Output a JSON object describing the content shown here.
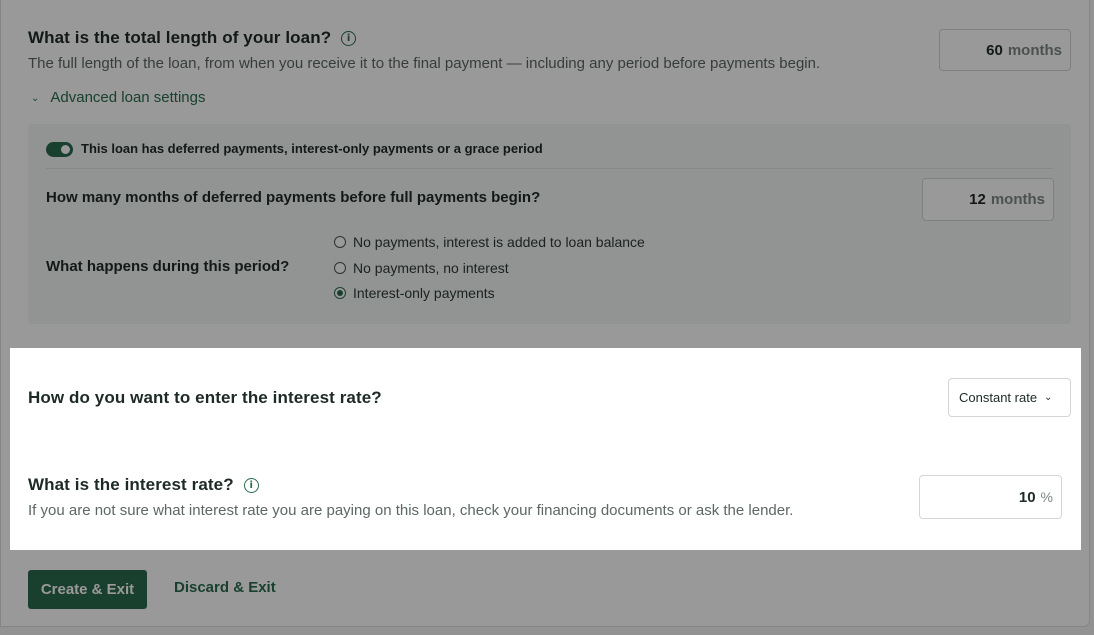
{
  "loan_length": {
    "question": "What is the total length of your loan?",
    "description": "The full length of the loan, from when you receive it to the final payment — including any period before payments begin.",
    "value": "60",
    "unit": "months"
  },
  "advanced_settings": {
    "label": "Advanced loan settings",
    "toggle_label": "This loan has deferred payments, interest-only payments or a grace period",
    "toggle_on": true,
    "deferred_question": "How many months of deferred payments before full payments begin?",
    "deferred_value": "12",
    "deferred_unit": "months",
    "period_question": "What happens during this period?",
    "period_options": [
      {
        "label": "No payments, interest is added to loan balance",
        "selected": false
      },
      {
        "label": "No payments, no interest",
        "selected": false
      },
      {
        "label": "Interest-only payments",
        "selected": true
      }
    ]
  },
  "interest_entry": {
    "question": "How do you want to enter the interest rate?",
    "selected": "Constant rate"
  },
  "interest_rate": {
    "question": "What is the interest rate?",
    "description": "If you are not sure what interest rate you are paying on this loan, check your financing documents or ask the lender.",
    "value": "10",
    "unit": "%"
  },
  "actions": {
    "primary": "Create & Exit",
    "secondary": "Discard & Exit"
  },
  "colors": {
    "accent": "#2b6b4e",
    "text": "#1e2a26",
    "muted": "#5d6764"
  }
}
